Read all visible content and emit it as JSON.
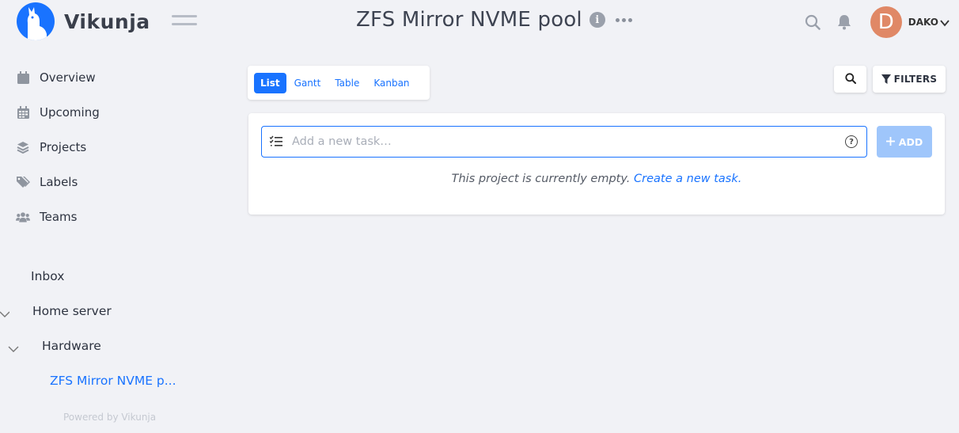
{
  "app": {
    "name": "Vikunja"
  },
  "header": {
    "project_title": "ZFS Mirror NVME pool",
    "info_glyph": "i",
    "user_initial": "D",
    "username": "DAKO"
  },
  "sidebar": {
    "nav": [
      {
        "label": "Overview",
        "icon": "calendar-icon"
      },
      {
        "label": "Upcoming",
        "icon": "calendar-grid-icon"
      },
      {
        "label": "Projects",
        "icon": "layers-icon"
      },
      {
        "label": "Labels",
        "icon": "tags-icon"
      },
      {
        "label": "Teams",
        "icon": "users-icon"
      }
    ],
    "projects": [
      {
        "label": "Inbox"
      },
      {
        "label": "Home server"
      },
      {
        "label": "Hardware"
      },
      {
        "label": "ZFS Mirror NVME p..."
      }
    ],
    "powered_by": "Powered by Vikunja"
  },
  "views": [
    {
      "label": "List",
      "active": true
    },
    {
      "label": "Gantt",
      "active": false
    },
    {
      "label": "Table",
      "active": false
    },
    {
      "label": "Kanban",
      "active": false
    }
  ],
  "toolbar": {
    "filters_label": "FILTERS"
  },
  "task_input": {
    "placeholder": "Add a new task…",
    "add_label": "ADD",
    "help_glyph": "?"
  },
  "empty_state": {
    "text": "This project is currently empty.",
    "link": "Create a new task."
  },
  "colors": {
    "accent": "#1973ff",
    "avatar": "#e08866",
    "add_button_disabled": "#9fc6fb",
    "background": "#f1f2f6"
  }
}
